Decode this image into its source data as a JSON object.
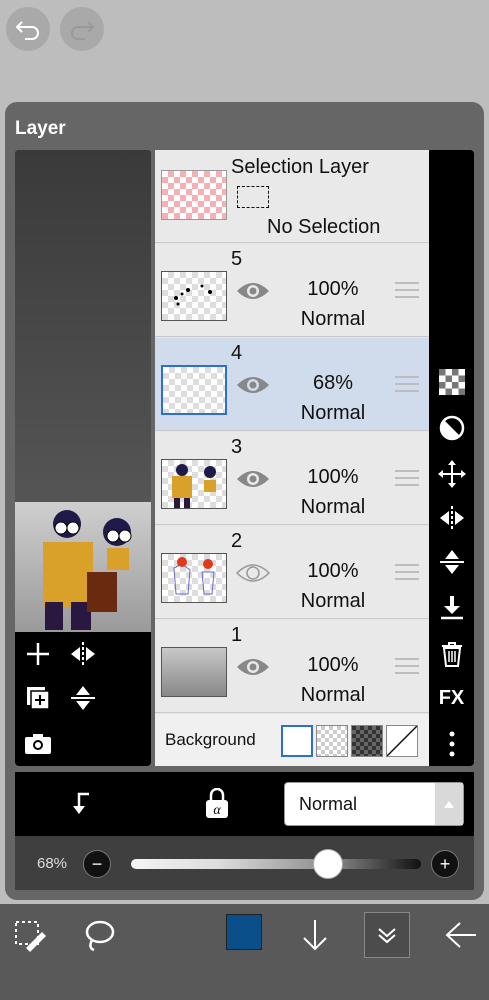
{
  "panel": {
    "title": "Layer"
  },
  "selection_layer": {
    "title": "Selection Layer",
    "status": "No Selection"
  },
  "layers": [
    {
      "number": "5",
      "opacity": "100%",
      "blend": "Normal",
      "visible": true
    },
    {
      "number": "4",
      "opacity": "68%",
      "blend": "Normal",
      "visible": true,
      "selected": true
    },
    {
      "number": "3",
      "opacity": "100%",
      "blend": "Normal",
      "visible": true
    },
    {
      "number": "2",
      "opacity": "100%",
      "blend": "Normal",
      "visible": false
    },
    {
      "number": "1",
      "opacity": "100%",
      "blend": "Normal",
      "visible": true
    }
  ],
  "background": {
    "label": "Background"
  },
  "right_toolbar": {
    "fx_label": "FX"
  },
  "blend_mode": {
    "value": "Normal"
  },
  "opacity_slider": {
    "label": "68%",
    "minus": "−",
    "plus": "+",
    "level": 0.68
  },
  "brush_color": "#0a4f8a",
  "icons": {
    "undo": "undo-icon",
    "redo": "redo-icon",
    "add_layer": "plus-icon",
    "flip_h": "flip-horizontal-icon",
    "merge": "merge-icon",
    "flip_v": "flip-vertical-icon",
    "camera": "camera-icon",
    "checker": "checker-icon",
    "reverse": "half-circle-icon",
    "move": "move-icon",
    "merge_down": "merge-down-icon",
    "trash": "trash-icon",
    "more": "more-icon",
    "clip": "clip-icon",
    "alpha_lock": "alpha-lock-icon"
  }
}
